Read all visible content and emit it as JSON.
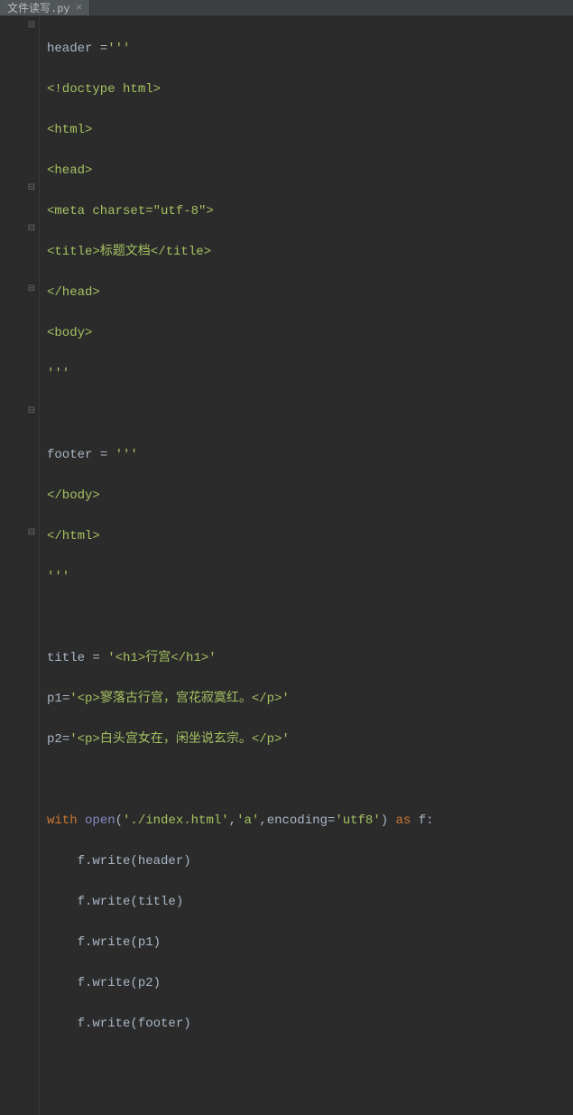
{
  "tab": {
    "filename": "文件读写.py",
    "close_glyph": "×"
  },
  "code": {
    "l1": "header ='''",
    "l2": "<!doctype html>",
    "l3": "<html>",
    "l4": "<head>",
    "l5": "<meta charset=\"utf-8\">",
    "l6": "<title>标题文档</title>",
    "l7": "</head>",
    "l8": "<body>",
    "l9": "'''",
    "l10": "",
    "l11": "footer = '''",
    "l12": "</body>",
    "l13": "</html>",
    "l14": "'''",
    "l15": "",
    "l16": "title = '<h1>行宫</h1>'",
    "l17": "p1='<p>寥落古行宫，宫花寂寞红。</p>'",
    "l18": "p2='<p>白头宫女在，闲坐说玄宗。</p>'",
    "l19": "",
    "l20a": "with ",
    "l20b": "open",
    "l20c": "(",
    "l20d": "'./index.html'",
    "l20e": ",",
    "l20f": "'a'",
    "l20g": ",",
    "l20h": "encoding",
    "l20i": "=",
    "l20j": "'utf8'",
    "l20k": ") ",
    "l20l": "as ",
    "l20m": "f:",
    "l21": "    f.write(header)",
    "l22": "    f.write(title)",
    "l23": "    f.write(p1)",
    "l24": "    f.write(p2)",
    "l25": "    f.write(footer)",
    "l26": ""
  },
  "folds": [
    {
      "line": 1,
      "glyph": "⊟"
    },
    {
      "line": 9,
      "glyph": "⊟"
    },
    {
      "line": 11,
      "glyph": "⊟"
    },
    {
      "line": 14,
      "glyph": "⊟"
    },
    {
      "line": 20,
      "glyph": "⊟"
    },
    {
      "line": 26,
      "glyph": "⊟"
    }
  ]
}
